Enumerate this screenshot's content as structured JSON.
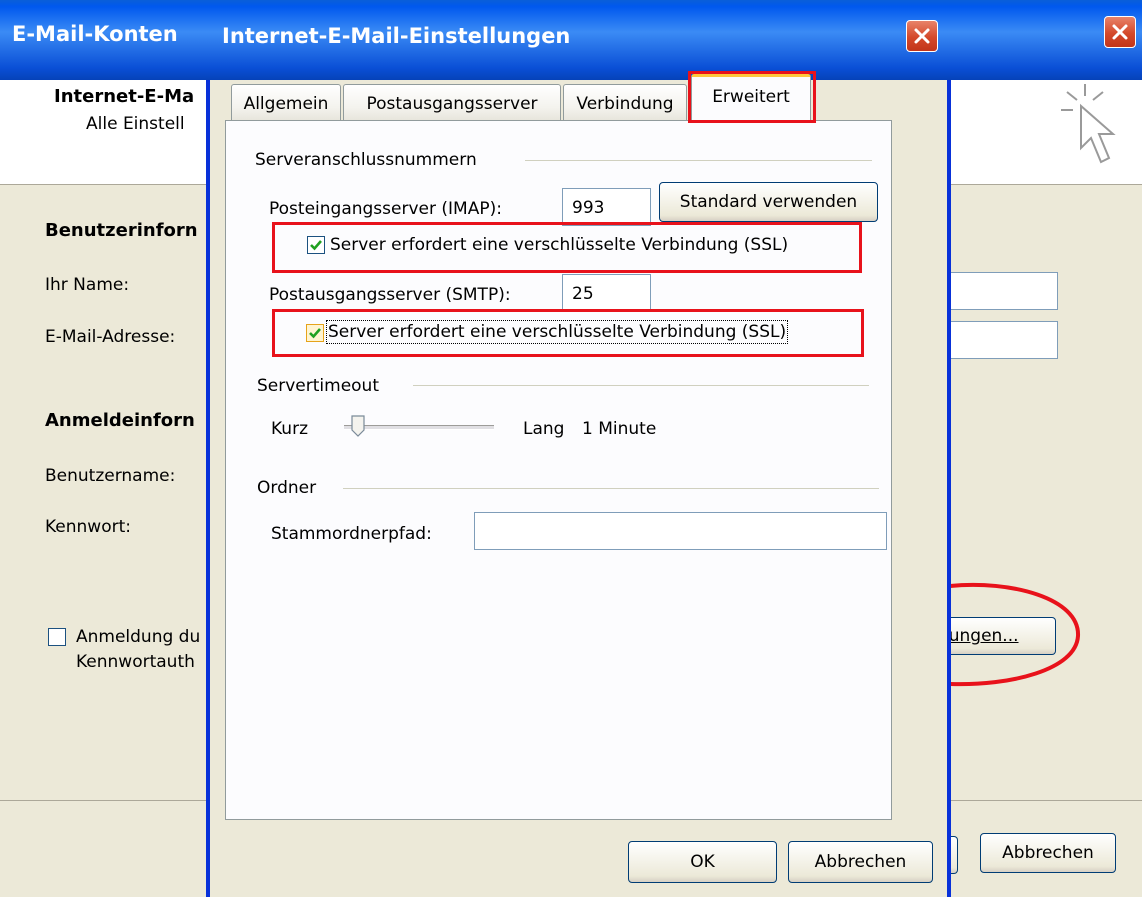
{
  "back_window": {
    "title": "E-Mail-Konten",
    "header_title": "Internet-E-Ma",
    "header_subtitle": "Alle Einstell",
    "section_user": "Benutzerinforn",
    "label_name": "Ihr Name:",
    "label_email": "E-Mail-Adresse:",
    "section_login": "Anmeldeinforn",
    "label_username": "Benutzername:",
    "label_password": "Kennwort:",
    "auth_checkbox_line1": "Anmeldung du",
    "auth_checkbox_line2": "Kennwortauth",
    "more_settings_button": "lungen...",
    "cancel_button": "Abbrechen"
  },
  "dialog": {
    "title": "Internet-E-Mail-Einstellungen",
    "tabs": [
      {
        "label": "Allgemein",
        "active": false
      },
      {
        "label": "Postausgangsserver",
        "active": false
      },
      {
        "label": "Verbindung",
        "active": false
      },
      {
        "label": "Erweitert",
        "active": true
      }
    ],
    "server_ports": {
      "group_label": "Serveranschlussnummern",
      "incoming_label": "Posteingangsserver (IMAP):",
      "incoming_value": "993",
      "default_button": "Standard verwenden",
      "incoming_ssl_label": "Server erfordert eine verschlüsselte Verbindung (SSL)",
      "incoming_ssl_checked": true,
      "outgoing_label": "Postausgangsserver (SMTP):",
      "outgoing_value": "25",
      "outgoing_ssl_label": "Server erfordert eine verschlüsselte Verbindung (SSL)",
      "outgoing_ssl_checked": true
    },
    "timeout": {
      "group_label": "Servertimeout",
      "short_label": "Kurz",
      "long_label": "Lang",
      "value_text": "1 Minute",
      "slider_fraction": 0.05
    },
    "folders": {
      "group_label": "Ordner",
      "root_path_label": "Stammordnerpfad:",
      "root_path_value": ""
    },
    "ok_button": "OK",
    "cancel_button": "Abbrechen"
  },
  "colors": {
    "titlebar": "#0a4fd6",
    "highlight": "#e8121b",
    "dialog_bg": "#ece9d8",
    "checkmark": "#21a121"
  },
  "icons": [
    "close-icon",
    "cursor-sparkle-icon",
    "checkmark-icon",
    "slider-thumb-icon"
  ]
}
